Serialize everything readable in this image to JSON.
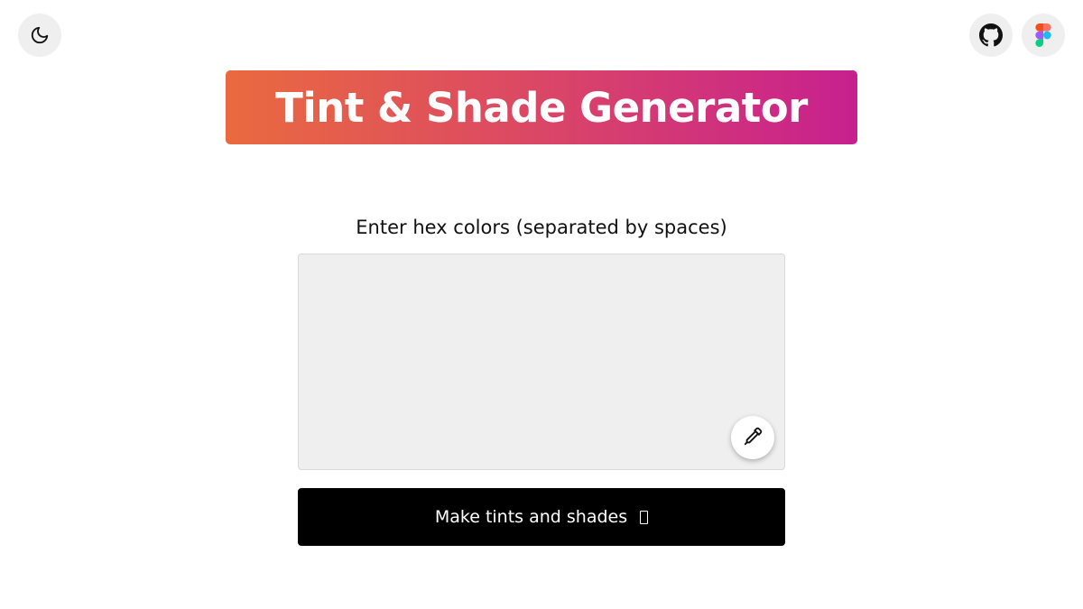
{
  "header": {
    "theme_toggle": {
      "icon": "moon-icon"
    },
    "github_link": {
      "icon": "github-icon"
    },
    "figma_link": {
      "icon": "figma-icon"
    }
  },
  "title": {
    "text": "Tint & Shade Generator",
    "gradient_start": "#ea6a3f",
    "gradient_end": "#c7208f"
  },
  "form": {
    "label": "Enter hex colors (separated by spaces)",
    "textarea_value": "",
    "picker_icon": "eyedropper-icon",
    "submit_label": "Make tints and shades",
    "submit_emoji": "missing-glyph-icon"
  },
  "colors": {
    "background": "#ffffff",
    "icon_button_bg": "#efefef",
    "textarea_bg": "#efefef",
    "submit_bg": "#000000"
  }
}
